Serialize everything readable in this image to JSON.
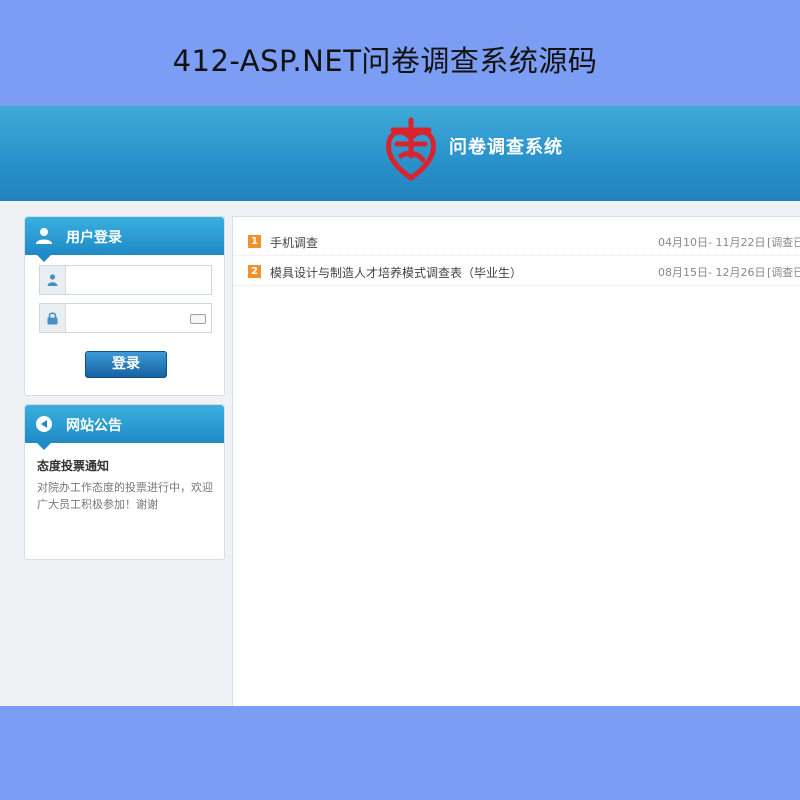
{
  "caption": "412-ASP.NET问卷调查系统源码",
  "header": {
    "logo_text": "问卷调查系统",
    "brand_color": "#2a93cc",
    "logo_color": "#d9232d"
  },
  "login": {
    "title": "用户登录",
    "username_value": "",
    "password_value": "",
    "button_label": "登录"
  },
  "notice": {
    "title": "网站公告",
    "heading": "态度投票通知",
    "body": "对院办工作态度的投票进行中，欢迎广大员工积极参加！谢谢"
  },
  "surveys": [
    {
      "num": "1",
      "title": "手机调查",
      "date": "04月10日- 11月22日",
      "status": "[调查已"
    },
    {
      "num": "2",
      "title": "模具设计与制造人才培养模式调查表（毕业生）",
      "date": "08月15日- 12月26日",
      "status": "[调查已"
    }
  ]
}
